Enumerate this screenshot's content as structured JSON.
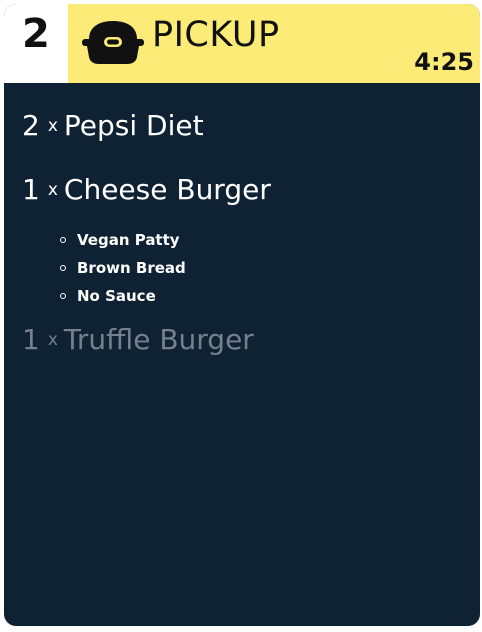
{
  "order": {
    "number": "2",
    "type_label": "PICKUP",
    "type_icon": "pickup-bag-icon",
    "timer": "4:25"
  },
  "colors": {
    "header_bg": "#fcec77",
    "ticket_bg": "#0e2233",
    "text": "#ffffff",
    "done_text": "#75808c"
  },
  "items": [
    {
      "qty": "2",
      "x": "x",
      "name": "Pepsi Diet",
      "done": false,
      "modifiers": []
    },
    {
      "qty": "1",
      "x": "x",
      "name": "Cheese Burger",
      "done": false,
      "modifiers": [
        "Vegan Patty",
        "Brown Bread",
        "No Sauce"
      ]
    },
    {
      "qty": "1",
      "x": "x",
      "name": "Truffle Burger",
      "done": true,
      "modifiers": []
    }
  ]
}
